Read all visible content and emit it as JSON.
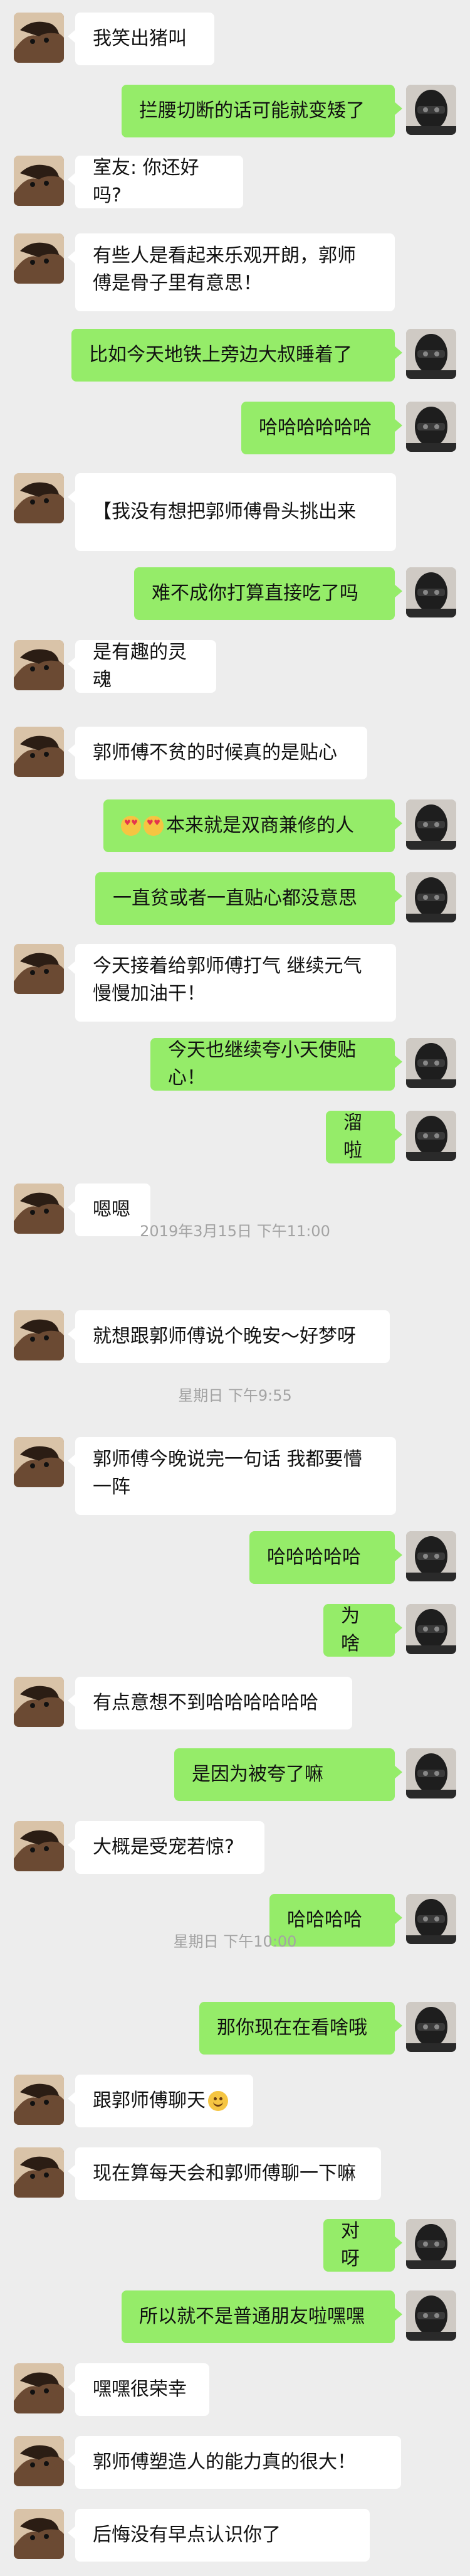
{
  "messages": [
    {
      "side": "left",
      "text": "我笑出猪叫"
    },
    {
      "side": "right",
      "text": "拦腰切断的话可能就变矮了"
    },
    {
      "side": "left",
      "text": "室友: 你还好吗?"
    },
    {
      "side": "left",
      "lines": [
        "有些人是看起来乐观开朗，郭师",
        "傅是骨子里有意思！"
      ]
    },
    {
      "side": "right",
      "text": "比如今天地铁上旁边大叔睡着了"
    },
    {
      "side": "right",
      "text": "哈哈哈哈哈哈"
    },
    {
      "side": "left",
      "text": "【我没有想把郭师傅骨头挑出来"
    },
    {
      "side": "right",
      "text": "难不成你打算直接吃了吗"
    },
    {
      "side": "left",
      "text": "是有趣的灵魂"
    },
    {
      "side": "left",
      "text": "郭师傅不贫的时候真的是贴心"
    },
    {
      "side": "right",
      "emoji": [
        "heart",
        "heart"
      ],
      "text": "本来就是双商兼修的人"
    },
    {
      "side": "right",
      "text": "一直贫或者一直贴心都没意思"
    },
    {
      "side": "left",
      "lines": [
        "今天接着给郭师傅打气 继续元气",
        "慢慢加油干！"
      ]
    },
    {
      "side": "right",
      "text": "今天也继续夸小天使贴心！"
    },
    {
      "side": "right",
      "text": "溜啦"
    },
    {
      "side": "left",
      "text": "嗯嗯"
    },
    {
      "timestamp": "2019年3月15日 下午11:00"
    },
    {
      "side": "left",
      "text": "就想跟郭师傅说个晚安～好梦呀"
    },
    {
      "timestamp": "星期日 下午9:55"
    },
    {
      "side": "left",
      "lines": [
        "郭师傅今晚说完一句话 我都要懵",
        "一阵"
      ]
    },
    {
      "side": "right",
      "text": "哈哈哈哈哈"
    },
    {
      "side": "right",
      "text": "为啥"
    },
    {
      "side": "left",
      "text": "有点意想不到哈哈哈哈哈哈"
    },
    {
      "side": "right",
      "text": "是因为被夸了嘛"
    },
    {
      "side": "left",
      "text": "大概是受宠若惊?"
    },
    {
      "side": "right",
      "text": "哈哈哈哈"
    },
    {
      "timestamp": "星期日 下午10:00"
    },
    {
      "side": "right",
      "text": "那你现在在看啥哦"
    },
    {
      "side": "left",
      "text": "跟郭师傅聊天",
      "emoji_after": "smile"
    },
    {
      "side": "left",
      "text": "现在算每天会和郭师傅聊一下嘛"
    },
    {
      "side": "right",
      "text": "对呀"
    },
    {
      "side": "right",
      "text": "所以就不是普通朋友啦嘿嘿"
    },
    {
      "side": "left",
      "text": "嘿嘿很荣幸"
    },
    {
      "side": "left",
      "text": "郭师傅塑造人的能力真的很大！"
    },
    {
      "side": "left",
      "text": "后悔没有早点认识你了"
    }
  ],
  "colors": {
    "background": "#ededed",
    "left_bubble": "#ffffff",
    "right_bubble": "#95ec69",
    "timestamp": "#a3a3a3"
  },
  "icons": {
    "left_avatar": "cat-photo-avatar",
    "right_avatar": "masked-man-avatar"
  }
}
